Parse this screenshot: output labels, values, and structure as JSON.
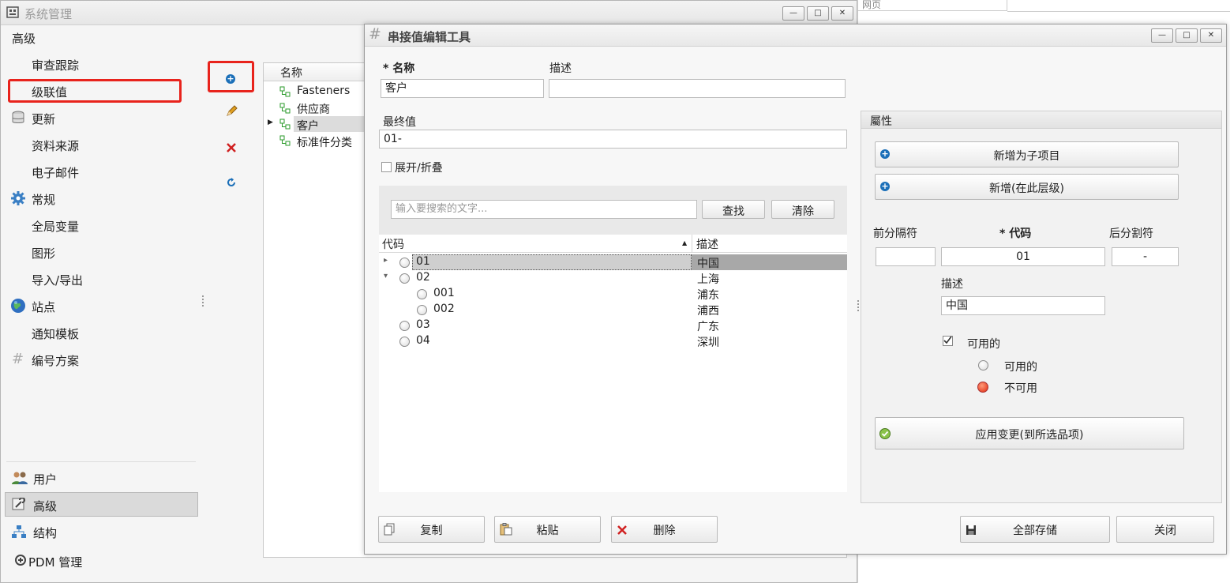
{
  "top_right": {
    "tab_label": "网页"
  },
  "main_window": {
    "title": "系统管理",
    "controls": [
      "—",
      "□",
      "✕"
    ],
    "section_header": "高级",
    "nav_items": [
      {
        "label": "审查跟踪"
      },
      {
        "label": "级联值",
        "highlighted": true
      },
      {
        "label": "更新",
        "icon": "database-icon"
      },
      {
        "label": "资料来源"
      },
      {
        "label": "电子邮件"
      },
      {
        "label": "常规",
        "icon": "gear-icon"
      },
      {
        "label": "全局变量"
      },
      {
        "label": "图形"
      },
      {
        "label": "导入/导出"
      },
      {
        "label": "站点",
        "icon": "globe-icon"
      },
      {
        "label": "通知模板"
      },
      {
        "label": "编号方案",
        "icon": "hash-icon"
      }
    ],
    "bottom_nav": [
      {
        "label": "用户",
        "icon": "users-icon"
      },
      {
        "label": "高级",
        "icon": "wrench-icon",
        "selected": true
      },
      {
        "label": "结构",
        "icon": "structure-icon"
      },
      {
        "label": "PDM 管理",
        "icon": "pdm-icon"
      }
    ],
    "list": {
      "header": "名称",
      "rows": [
        {
          "label": "Fasteners"
        },
        {
          "label": "供应商"
        },
        {
          "label": "客户",
          "selected": true
        },
        {
          "label": "标准件分类"
        }
      ]
    }
  },
  "dialog": {
    "title": "串接值编辑工具",
    "controls": [
      "—",
      "□",
      "✕"
    ],
    "name_label": "* 名称",
    "name_value": "客户",
    "desc_label": "描述",
    "desc_value": "",
    "final_label": "最终值",
    "final_value": "01-",
    "expand_label": "展开/折叠",
    "search_placeholder": "输入要搜索的文字...",
    "find_button": "查找",
    "clear_button": "清除",
    "tree_headers": {
      "code": "代码",
      "desc": "描述"
    },
    "tree_rows": [
      {
        "code": "01",
        "desc": "中国",
        "level": 0,
        "expander": "▸",
        "selected": true
      },
      {
        "code": "02",
        "desc": "上海",
        "level": 0,
        "expander": "▾"
      },
      {
        "code": "001",
        "desc": "浦东",
        "level": 1,
        "expander": ""
      },
      {
        "code": "002",
        "desc": "浦西",
        "level": 1,
        "expander": ""
      },
      {
        "code": "03",
        "desc": "广东",
        "level": 0,
        "expander": ""
      },
      {
        "code": "04",
        "desc": "深圳",
        "level": 0,
        "expander": ""
      }
    ],
    "properties": {
      "title": "屬性",
      "add_child_button": "新增为子项目",
      "add_sibling_button": "新增(在此层级)",
      "prefix_label": "前分隔符",
      "code_label": "* 代码",
      "suffix_label": "后分割符",
      "prefix_value": "",
      "code_value": "01",
      "suffix_value": "-",
      "desc_label": "描述",
      "desc_value": "中国",
      "enabled_checkbox_label": "可用的",
      "radio_available": "可用的",
      "radio_unavailable": "不可用",
      "apply_button": "应用变更(到所选品项)"
    },
    "copy_button": "复制",
    "paste_button": "粘贴",
    "delete_button": "删除",
    "save_all_button": "全部存储",
    "close_button": "关闭"
  },
  "colors": {
    "highlight_red": "#e8231c",
    "accent_blue": "#1b6fb8",
    "selected_gray": "#a8a8a8"
  }
}
